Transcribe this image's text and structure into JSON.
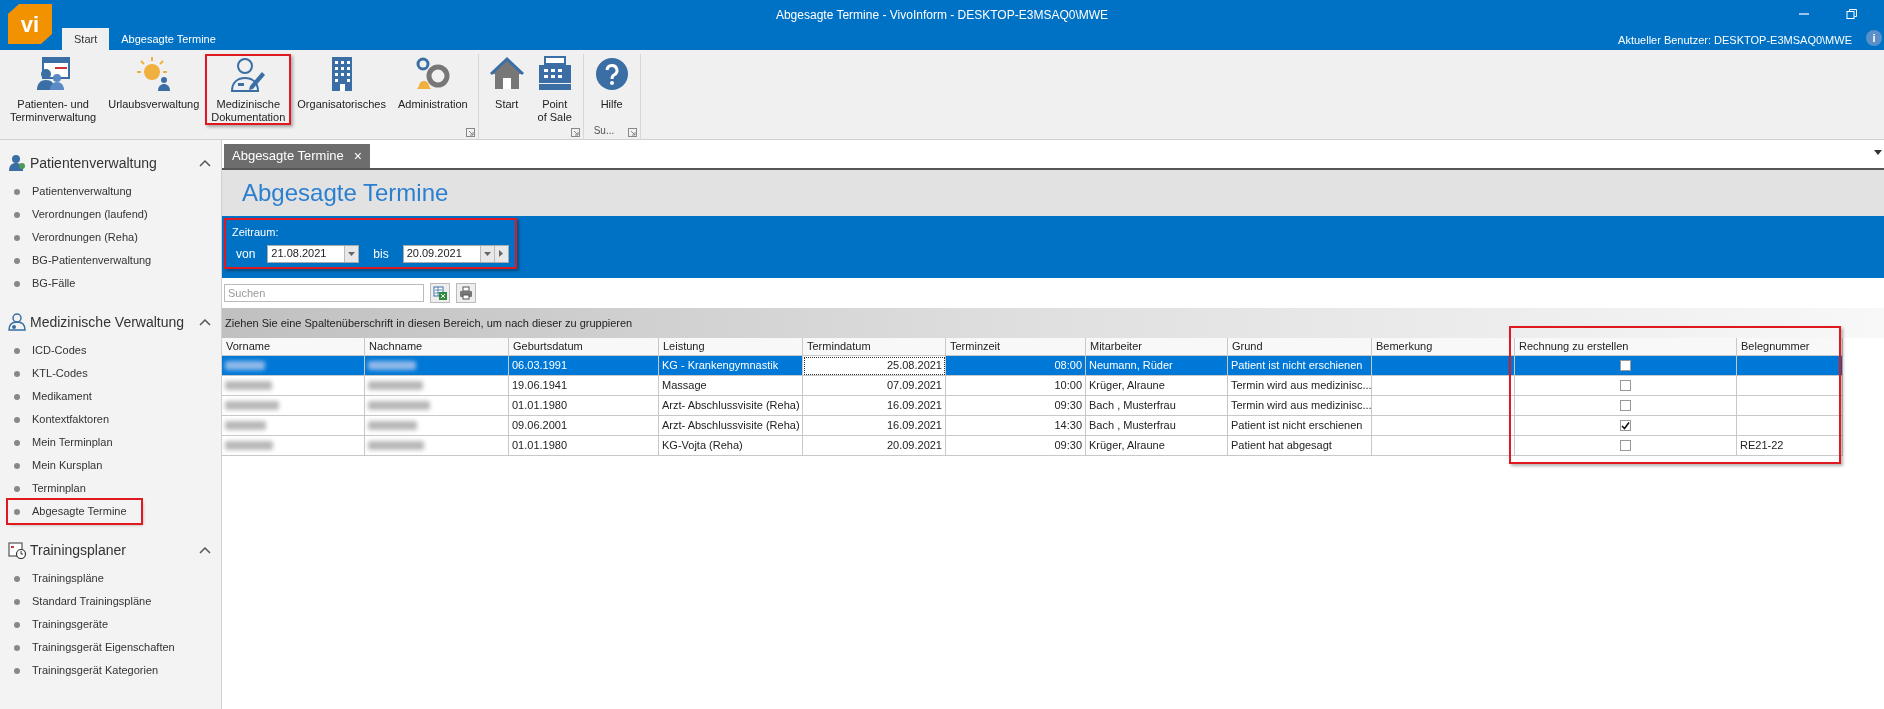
{
  "window": {
    "title": "Abgesagte Termine - VivoInform - DESKTOP-E3MSAQ0\\MWE",
    "logo": "vi",
    "user": "Aktueller Benutzer: DESKTOP-E3MSAQ0\\MWE",
    "info": "i"
  },
  "ribbon_tabs": [
    {
      "label": "Start",
      "selected": true
    },
    {
      "label": "Abgesagte Termine",
      "selected": false
    }
  ],
  "ribbon_groups": [
    {
      "items": [
        {
          "label": "Patienten- und\nTerminverwaltung",
          "kind": "patients",
          "highlighted": false
        },
        {
          "label": "Urlaubsverwaltung",
          "kind": "vacation",
          "highlighted": false
        },
        {
          "label": "Medizinische\nDokumentation",
          "kind": "doctor",
          "highlighted": true
        },
        {
          "label": "Organisatorisches",
          "kind": "building",
          "highlighted": false
        },
        {
          "label": "Administration",
          "kind": "gears",
          "highlighted": false
        }
      ]
    },
    {
      "items": [
        {
          "label": "Start",
          "kind": "home",
          "highlighted": false
        },
        {
          "label": "Point\nof Sale",
          "kind": "register",
          "highlighted": false
        }
      ]
    },
    {
      "label": "Su...",
      "items": [
        {
          "label": "Hilfe",
          "kind": "help",
          "highlighted": false
        }
      ]
    }
  ],
  "sidebar": [
    {
      "title": "Patientenverwaltung",
      "kind": "patients",
      "expanded": true,
      "items": [
        {
          "label": "Patientenverwaltung",
          "highlighted": false
        },
        {
          "label": "Verordnungen (laufend)",
          "highlighted": false
        },
        {
          "label": "Verordnungen (Reha)",
          "highlighted": false
        },
        {
          "label": "BG-Patientenverwaltung",
          "highlighted": false
        },
        {
          "label": "BG-Fälle",
          "highlighted": false
        }
      ]
    },
    {
      "title": "Medizinische Verwaltung",
      "kind": "medical",
      "expanded": true,
      "items": [
        {
          "label": "ICD-Codes",
          "highlighted": false
        },
        {
          "label": "KTL-Codes",
          "highlighted": false
        },
        {
          "label": "Medikament",
          "highlighted": false
        },
        {
          "label": "Kontextfaktoren",
          "highlighted": false
        },
        {
          "label": "Mein Terminplan",
          "highlighted": false
        },
        {
          "label": "Mein Kursplan",
          "highlighted": false
        },
        {
          "label": "Terminplan",
          "highlighted": false
        },
        {
          "label": "Abgesagte Termine",
          "highlighted": true
        }
      ]
    },
    {
      "title": "Trainingsplaner",
      "kind": "calendar",
      "expanded": true,
      "items": [
        {
          "label": "Trainingspläne",
          "highlighted": false
        },
        {
          "label": "Standard Trainingspläne",
          "highlighted": false
        },
        {
          "label": "Trainingsgeräte",
          "highlighted": false
        },
        {
          "label": "Trainingsgerät Eigenschaften",
          "highlighted": false
        },
        {
          "label": "Trainingsgerät Kategorien",
          "highlighted": false
        }
      ]
    }
  ],
  "document_tabs": [
    {
      "label": "Abgesagte Termine",
      "selected": true,
      "close": "×"
    }
  ],
  "page_title": "Abgesagte Termine",
  "filter": {
    "label": "Zeitraum:",
    "highlighted": true,
    "from_label": "von",
    "from": "21.08.2021",
    "to_label": "bis",
    "to": "20.09.2021"
  },
  "search": {
    "placeholder": "Suchen"
  },
  "group_panel": "Ziehen Sie eine Spaltenüberschrift in diesen Bereich, um nach dieser zu gruppieren",
  "table": {
    "invoice_columns_highlighted": true,
    "columns": [
      {
        "label": "Vorname"
      },
      {
        "label": "Nachname"
      },
      {
        "label": "Geburtsdatum"
      },
      {
        "label": "Leistung"
      },
      {
        "label": "Termindatum"
      },
      {
        "label": "Terminzeit"
      },
      {
        "label": "Mitarbeiter"
      },
      {
        "label": "Grund"
      },
      {
        "label": "Bemerkung"
      },
      {
        "label": "Rechnung zu erstellen"
      },
      {
        "label": "Belegnummer"
      }
    ],
    "rows": [
      {
        "selected": true,
        "birth": "06.03.1991",
        "service": "KG - Krankengymnastik",
        "date": "25.08.2021",
        "time": "08:00",
        "staff": "Neumann, Rüder",
        "reason": "Patient ist nicht erschienen",
        "invoice": false,
        "receipt": ""
      },
      {
        "selected": false,
        "birth": "19.06.1941",
        "service": "Massage",
        "date": "07.09.2021",
        "time": "10:00",
        "staff": "Krüger, Alraune",
        "reason": "Termin wird aus medizinisc...",
        "invoice": false,
        "receipt": ""
      },
      {
        "selected": false,
        "birth": "01.01.1980",
        "service": "Arzt- Abschlussvisite (Reha)",
        "date": "16.09.2021",
        "time": "09:30",
        "staff": "Bach , Musterfrau",
        "reason": "Termin wird aus medizinisc...",
        "invoice": false,
        "receipt": ""
      },
      {
        "selected": false,
        "birth": "09.06.2001",
        "service": "Arzt- Abschlussvisite (Reha)",
        "date": "16.09.2021",
        "time": "14:30",
        "staff": "Bach , Musterfrau",
        "reason": "Patient ist nicht erschienen",
        "invoice": true,
        "receipt": ""
      },
      {
        "selected": false,
        "birth": "01.01.1980",
        "service": "KG-Vojta (Reha)",
        "date": "20.09.2021",
        "time": "09:30",
        "staff": "Krüger, Alraune",
        "reason": "Patient hat abgesagt",
        "invoice": false,
        "receipt": "RE21-22"
      }
    ]
  }
}
